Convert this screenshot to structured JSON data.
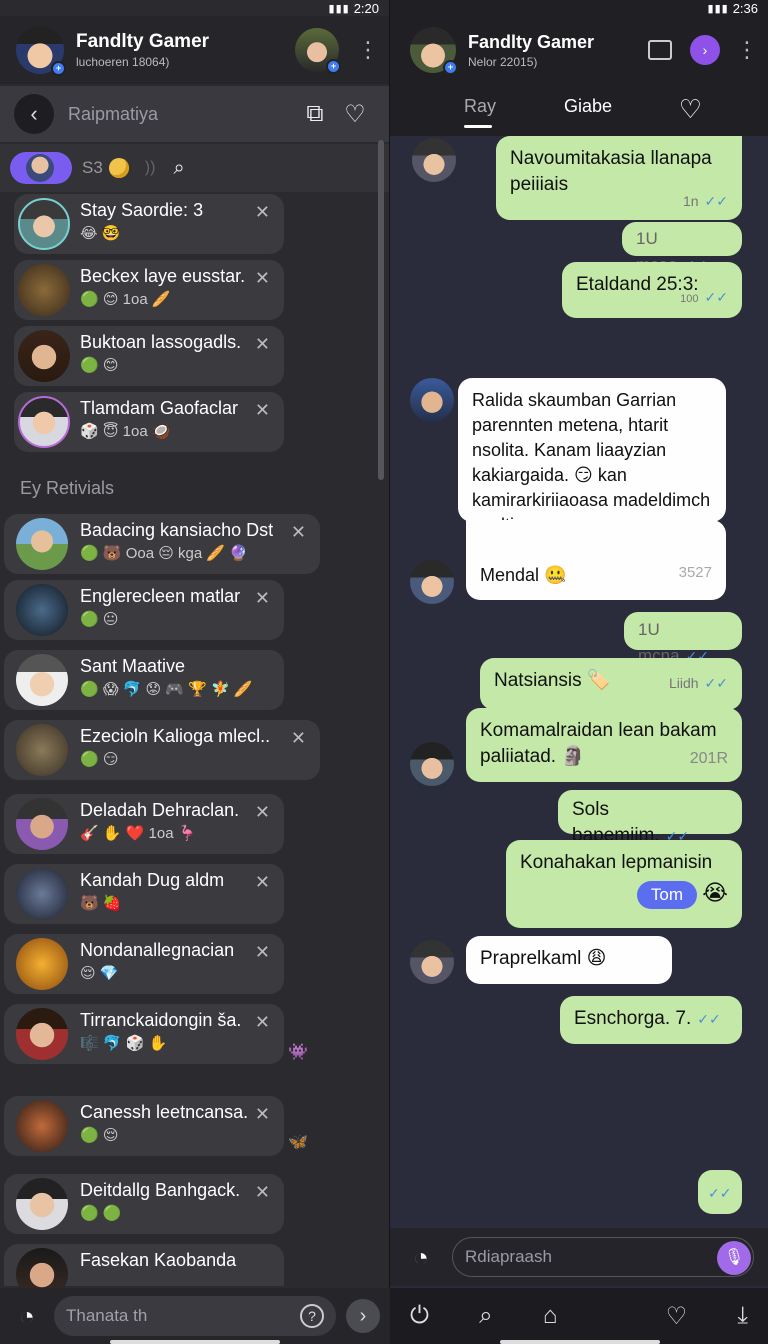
{
  "status": {
    "left_time": "",
    "right_time": "2:20",
    "right_time2": "2:36"
  },
  "left": {
    "header": {
      "title": "Fandlty Gamer",
      "subtitle": "luchoeren 18064)"
    },
    "search": {
      "placeholder": "Raipmatiya"
    },
    "filter": {
      "count": "S3"
    },
    "pinned": [
      {
        "name": "Stay Saordie: 3",
        "emoji": "😂 🤓"
      },
      {
        "name": "Beckex laye eusstar.",
        "emoji": "🟢 😊 1oa 🥖"
      },
      {
        "name": "Buktoan lassogadls.",
        "emoji": "🟢 😊"
      },
      {
        "name": "Tlamdam Gaofaclar",
        "emoji": "🎲 😇 1oa 🥥"
      }
    ],
    "section_title": "Ey Retivials",
    "items": [
      {
        "name": "Badacing kansiacho Dst",
        "emoji": "🟢 🐻 Ooa 😔 kga 🥖 🔮"
      },
      {
        "name": "Englerecleen matlar",
        "emoji": "🟢 😐"
      },
      {
        "name": "Sant Maative",
        "emoji": "🟢 😱 🐬 😟 🎮 🏆 🧚 🥖"
      },
      {
        "name": "Ezecioln Kaliogа mlecl..",
        "emoji": "🟢 😏"
      },
      {
        "name": "Deladah Dehraclan.",
        "emoji": "🎸 ✋ ❤️ 1oa 🦩"
      },
      {
        "name": "Kandah Dug aldm",
        "emoji": "🐻 🍓"
      },
      {
        "name": "Nondanallegnacian",
        "emoji": "😌 💎"
      },
      {
        "name": "Tirranckaidongin ša.",
        "emoji": "🎼 🐬 🎲 ✋"
      },
      {
        "name": "Canessh leetncansa.",
        "emoji": "🟢 😌"
      },
      {
        "name": "Deitdallg Banhgack.",
        "emoji": "🟢 🟢"
      },
      {
        "name": "Fasekan Kaobanda",
        "emoji": ""
      }
    ],
    "bottom": {
      "placeholder": "Thanata th"
    }
  },
  "right": {
    "header": {
      "title": "Fandlty Gamer",
      "subtitle": "Nelor 22015)"
    },
    "tabs": [
      "Ray",
      "Giabe"
    ],
    "messages": [
      {
        "dir": "out",
        "text": "Navoumitakasia llanapa peiiiais",
        "meta": "1n"
      },
      {
        "dir": "out",
        "text": "1U mcaa",
        "meta": ""
      },
      {
        "dir": "out",
        "text": "Etaldand 25:3:",
        "meta": "100"
      },
      {
        "dir": "in",
        "text": "Ralida skaumban Garrian parenntеn metena, htarit nsolita. Kanam liaayzian kakiargaida. 😏 kan kamirarkiriiaoasa madeldimch saaltiwa.",
        "meta": ""
      },
      {
        "dir": "in",
        "text": "Mendal 🤐",
        "meta": "3527"
      },
      {
        "dir": "out",
        "text": "1U mcna",
        "meta": ""
      },
      {
        "dir": "out",
        "text": "Natsiansis 🏷️",
        "meta": "Liidh"
      },
      {
        "dir": "out",
        "text": "Komamalraidan lean bakam paliiatad. 🗿",
        "meta": "201R"
      },
      {
        "dir": "out",
        "text": "Sols bapemiim.",
        "meta": ""
      },
      {
        "dir": "out",
        "text": "Konahakan lepmanisin",
        "meta": "",
        "pill": "Tom"
      },
      {
        "dir": "in",
        "text": "Praprelkaml 😩",
        "meta": ""
      },
      {
        "dir": "out",
        "text": "Esnchorga. 7.",
        "meta": ""
      }
    ],
    "composer": {
      "placeholder": "Rdiapraash"
    }
  },
  "colors": {
    "accent": "#7b5cf0",
    "bubble_out": "#c4e8a7",
    "bubble_in": "#fefefe",
    "left_bg": "#2b2b2f",
    "right_bg": "#2a2c3b"
  }
}
